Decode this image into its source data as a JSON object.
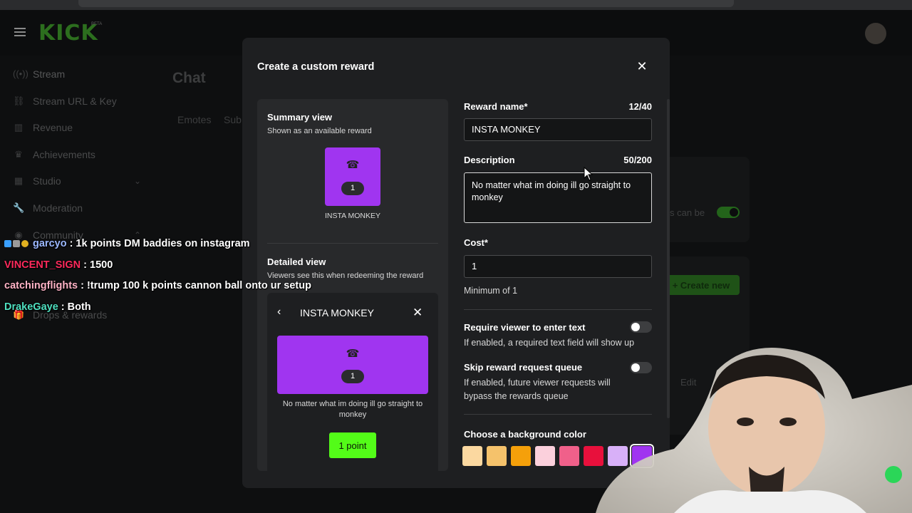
{
  "brand": {
    "logo": "KICK",
    "badge": "BETA"
  },
  "sidebar": {
    "items": [
      {
        "label": "Stream",
        "icon": "stream-icon"
      },
      {
        "label": "Stream URL & Key",
        "icon": "link-icon"
      },
      {
        "label": "Revenue",
        "icon": "chart-icon"
      },
      {
        "label": "Achievements",
        "icon": "trophy-icon"
      },
      {
        "label": "Studio",
        "icon": "studio-icon"
      },
      {
        "label": "Moderation",
        "icon": "wrench-icon"
      },
      {
        "label": "Community",
        "icon": "community-icon"
      },
      {
        "label": "Drops & rewards",
        "icon": "gift-icon"
      }
    ]
  },
  "background": {
    "page_title": "Chat",
    "tabs": [
      "Emotes",
      "Sub"
    ],
    "toggle_text": "s can be",
    "create_button": "+ Create new",
    "edit_text": "Edit"
  },
  "chat": [
    {
      "user": "garcyo",
      "user_color": "#9bb8ff",
      "text": ": 1k points DM baddies on instagram"
    },
    {
      "user": "VINCENT_SIGN",
      "user_color": "#ff2a5c",
      "text": ": 1500"
    },
    {
      "user": "catchingflights",
      "user_color": "#ffb3c6",
      "text": ": !trump 100 k points cannon ball onto ur setup"
    },
    {
      "user": "DrakeGaye",
      "user_color": "#4fe0c0",
      "text": ": Both"
    }
  ],
  "modal": {
    "title": "Create a custom reward",
    "preview": {
      "summary_heading": "Summary view",
      "summary_sub": "Shown as an available reward",
      "tile_count": "1",
      "tile_name": "INSTA MONKEY",
      "detail_heading": "Detailed view",
      "detail_sub": "Viewers see this when redeeming the reward",
      "detail_title": "INSTA MONKEY",
      "detail_count": "1",
      "detail_desc": "No matter what im doing ill go straight to monkey",
      "detail_button": "1 point"
    },
    "form": {
      "name_label": "Reward name*",
      "name_count": "12/40",
      "name_value": "INSTA MONKEY",
      "desc_label": "Description",
      "desc_count": "50/200",
      "desc_value": "No matter what im doing ill go straight to monkey ",
      "cost_label": "Cost*",
      "cost_value": "1",
      "cost_helper": "Minimum of 1",
      "require_text_label": "Require viewer to enter text",
      "require_text_helper": "If enabled, a required text field will show up",
      "require_text_on": false,
      "skip_queue_label": "Skip reward request queue",
      "skip_queue_helper": "If enabled, future viewer requests will bypass the rewards queue",
      "skip_queue_on": false,
      "bg_color_label": "Choose a background color",
      "colors": [
        "#fbd8a0",
        "#f5c26b",
        "#f5a00a",
        "#fbd0dc",
        "#f0608a",
        "#e8103c",
        "#d8b0f8",
        "#a035f0"
      ],
      "selected_color": "#a035f0"
    }
  }
}
